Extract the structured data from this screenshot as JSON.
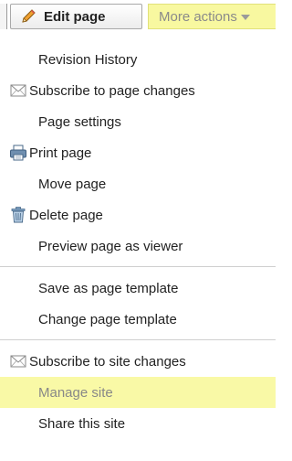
{
  "toolbar": {
    "edit_label": "Edit page",
    "more_label": "More actions",
    "colors": {
      "more_bg": "#f8f8a0",
      "more_text": "#8a8a8a",
      "highlight": "#f9f9a6"
    }
  },
  "menu": {
    "groups": [
      {
        "items": [
          {
            "label": "Revision History",
            "icon": ""
          },
          {
            "label": "Subscribe to page changes",
            "icon": "envelope-icon"
          },
          {
            "label": "Page settings",
            "icon": ""
          },
          {
            "label": "Print page",
            "icon": "printer-icon"
          },
          {
            "label": "Move page",
            "icon": ""
          },
          {
            "label": "Delete page",
            "icon": "trash-icon"
          },
          {
            "label": "Preview page as viewer",
            "icon": ""
          }
        ]
      },
      {
        "items": [
          {
            "label": "Save as page template",
            "icon": ""
          },
          {
            "label": "Change page template",
            "icon": ""
          }
        ]
      },
      {
        "items": [
          {
            "label": "Subscribe to site changes",
            "icon": "envelope-icon"
          },
          {
            "label": "Manage site",
            "icon": "",
            "highlighted": true
          },
          {
            "label": "Share this site",
            "icon": ""
          }
        ]
      }
    ]
  }
}
